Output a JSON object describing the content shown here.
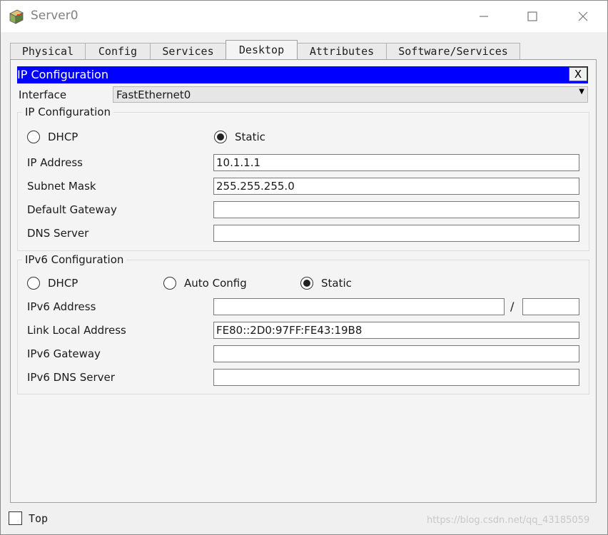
{
  "window": {
    "title": "Server0",
    "icons": {
      "app": "server-icon",
      "minimize": "minimize-icon",
      "maximize": "maximize-icon",
      "close": "close-icon"
    }
  },
  "tabs": [
    {
      "label": "Physical",
      "active": false
    },
    {
      "label": "Config",
      "active": false
    },
    {
      "label": "Services",
      "active": false
    },
    {
      "label": "Desktop",
      "active": true
    },
    {
      "label": "Attributes",
      "active": false
    },
    {
      "label": "Software/Services",
      "active": false
    }
  ],
  "panel": {
    "title": "IP Configuration",
    "close_label": "X",
    "title_bar_color": "#0000ff",
    "interface": {
      "label": "Interface",
      "value": "FastEthernet0"
    }
  },
  "ipv4": {
    "title": "IP Configuration",
    "mode_options": [
      {
        "label": "DHCP",
        "selected": false
      },
      {
        "label": "Static",
        "selected": true
      }
    ],
    "fields": [
      {
        "label": "IP Address",
        "value": "10.1.1.1"
      },
      {
        "label": "Subnet Mask",
        "value": "255.255.255.0"
      },
      {
        "label": "Default Gateway",
        "value": ""
      },
      {
        "label": "DNS Server",
        "value": ""
      }
    ]
  },
  "ipv6": {
    "title": "IPv6 Configuration",
    "mode_options": [
      {
        "label": "DHCP",
        "selected": false
      },
      {
        "label": "Auto Config",
        "selected": false
      },
      {
        "label": "Static",
        "selected": true
      }
    ],
    "address": {
      "label": "IPv6 Address",
      "value": "",
      "prefix_separator": "/",
      "prefix_value": ""
    },
    "fields": [
      {
        "label": "Link Local Address",
        "value": "FE80::2D0:97FF:FE43:19B8"
      },
      {
        "label": "IPv6 Gateway",
        "value": ""
      },
      {
        "label": "IPv6 DNS Server",
        "value": ""
      }
    ]
  },
  "footer": {
    "top_label": "Top",
    "top_checked": false
  },
  "watermark": "https://blog.csdn.net/qq_43185059"
}
